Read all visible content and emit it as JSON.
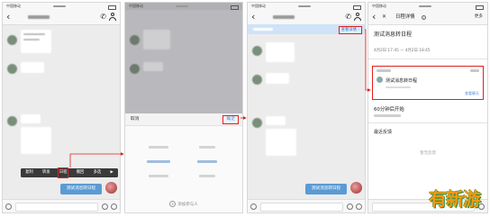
{
  "panels": {
    "chat": {
      "status_carrier": "中国移动",
      "menu": [
        "复制",
        "转发",
        "日程",
        "撤回",
        "多选"
      ],
      "menu_more": "▶",
      "bubble": "测试消息转日程"
    },
    "picker": {
      "status_carrier": "中国移动",
      "cancel": "取消",
      "confirm": "确定",
      "add_participant": "添加参与人"
    },
    "chat_added": {
      "status_carrier": "中国移动",
      "banner_action": "查看详情 ›",
      "bubble": "测试消息转日程"
    },
    "detail": {
      "status_carrier": "中国移动",
      "back": "‹",
      "close": "✕",
      "title": "日程详情",
      "more": "更多",
      "event_title": "测试消息转日程",
      "time": "4月2日 17:45 — 4月2日 18:45",
      "card_title": "测试消息转日程",
      "card_link": "查看聊天",
      "reminder": "60分钟后开始",
      "feedback_heading": "最近反馈",
      "feedback_empty": "暂无反馈"
    }
  },
  "watermark": "有新游",
  "colors": {
    "accent": "#4a90e2",
    "bubble": "#5b9bd5",
    "highlight": "#e02020",
    "banner": "#cfe2f7"
  },
  "icons": [
    "back-icon",
    "phone-icon",
    "person-icon",
    "close-icon",
    "info-icon",
    "plus-icon",
    "arrow-icon"
  ]
}
